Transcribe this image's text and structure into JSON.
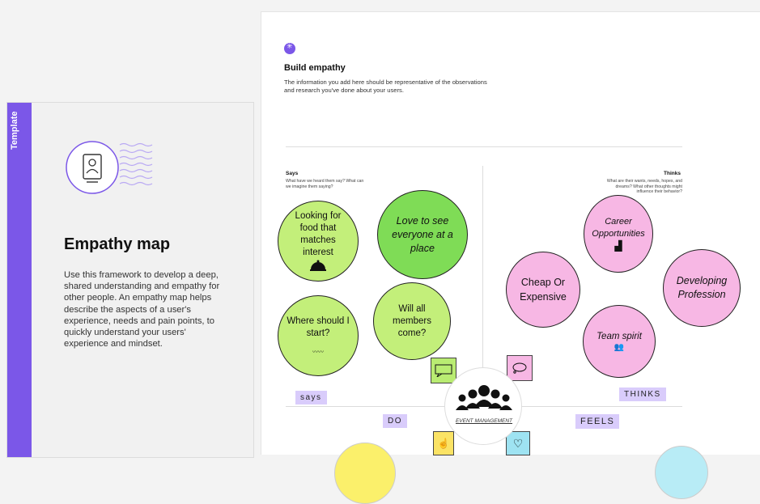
{
  "template_panel": {
    "tab_label": "Template",
    "title": "Empathy map",
    "description": "Use this framework to develop a deep, shared understanding and empathy for other people. An empathy map helps describe the aspects of a user's experience, needs and pain points, to quickly understand your users' experience and mindset."
  },
  "canvas": {
    "build_title": "Build empathy",
    "build_description": "The information you add here should be representative of the observations and research you've done about your users.",
    "says": {
      "title": "Says",
      "subtitle": "What have we heard them say? What can we imagine them saying?"
    },
    "thinks": {
      "title": "Thinks",
      "subtitle": "What are their wants, needs, hopes, and dreams? What other thoughts might influence their behavior?"
    },
    "bubbles": {
      "looking_for_food": "Looking for food that matches interest",
      "love_to_see": "Love to see everyone at a place",
      "where_start": "Where should I start?",
      "will_all": "Will all members come?",
      "career": "Career Opportunities",
      "cheap": "Cheap Or Expensive",
      "developing": "Developing Profession",
      "team_spirit": "Team spirit"
    },
    "tags": {
      "says": "says",
      "thinks": "THINKS",
      "do": "DO",
      "feels": "FEELS"
    },
    "center_label": "EVENT MANAGEMENT"
  },
  "colors": {
    "accent": "#7b57e8",
    "green": "#c3ef7a",
    "pink": "#f7b7e4",
    "tag": "#d9ccfb"
  }
}
